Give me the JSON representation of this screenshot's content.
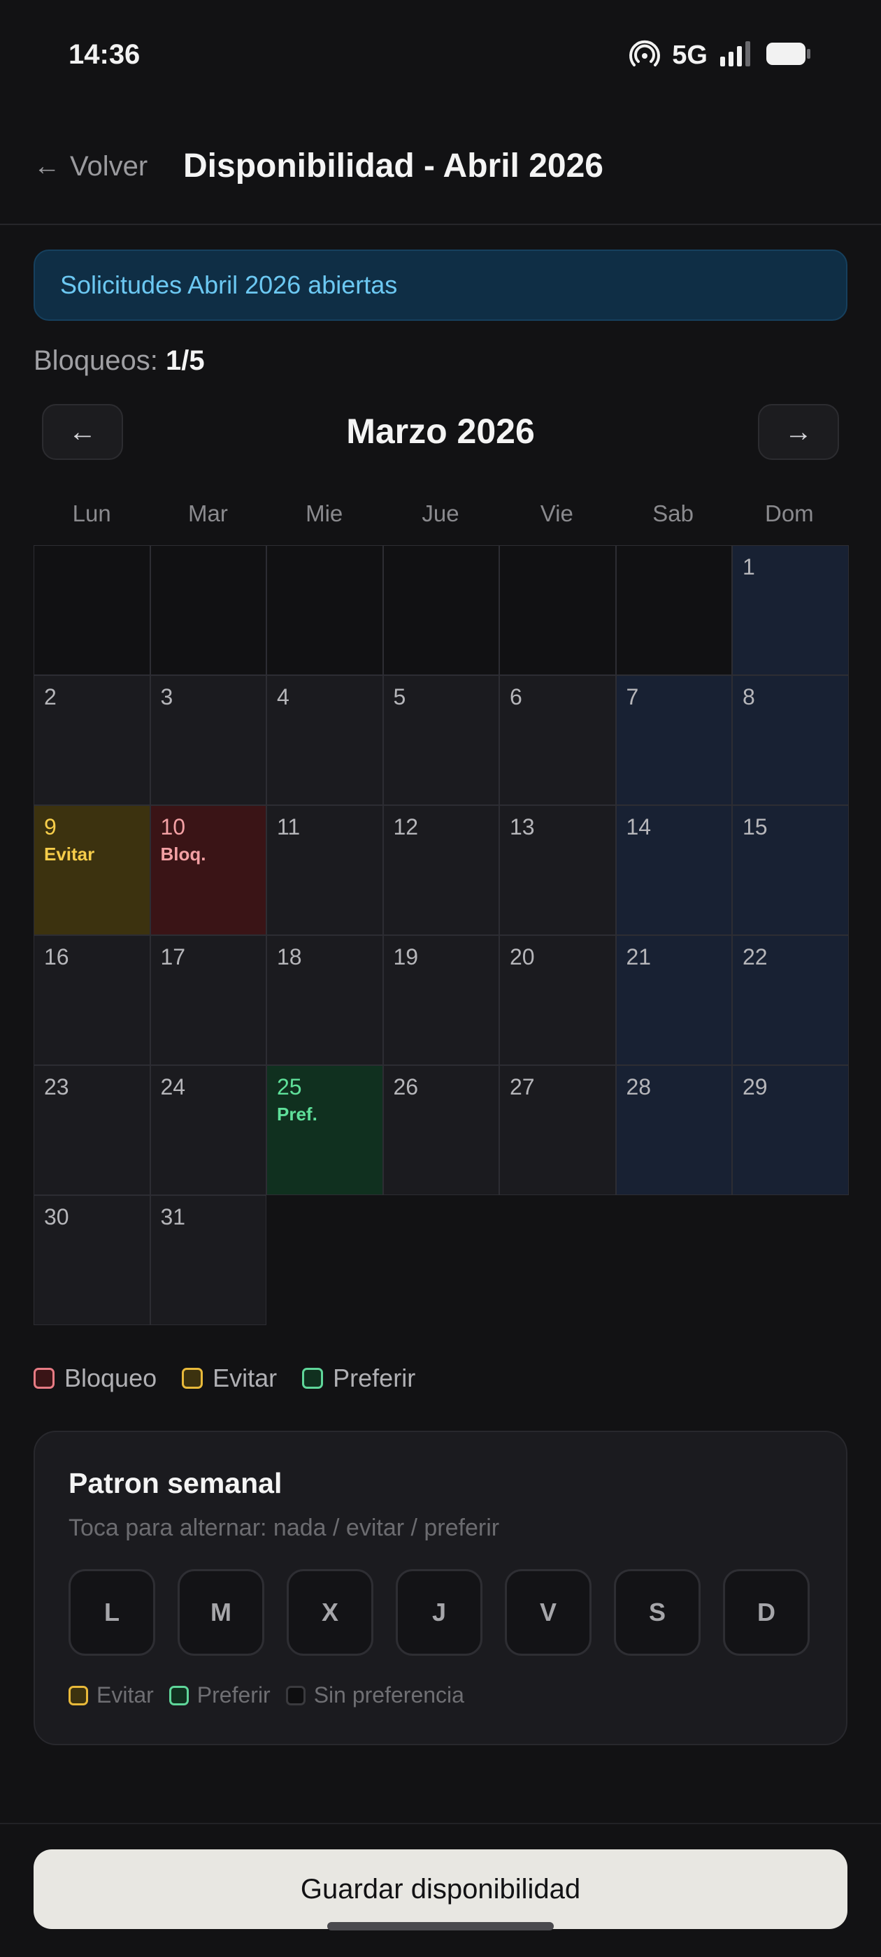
{
  "status_bar": {
    "time": "14:36",
    "network": "5G",
    "icons": [
      "hotspot-icon",
      "signal-icon",
      "battery-icon"
    ]
  },
  "header": {
    "back_label": "Volver",
    "back_arrow": "←",
    "title": "Disponibilidad - Abril 2026"
  },
  "banner": {
    "text": "Solicitudes Abril 2026 abiertas"
  },
  "blocks": {
    "label": "Bloqueos:",
    "value": "1/5"
  },
  "calendar": {
    "prev_label": "←",
    "next_label": "→",
    "month_title": "Marzo 2026",
    "weekdays": [
      "Lun",
      "Mar",
      "Mie",
      "Jue",
      "Vie",
      "Sab",
      "Dom"
    ],
    "leading_empty": 6,
    "days": [
      {
        "n": "1",
        "state": "weekend",
        "tag": ""
      },
      {
        "n": "2",
        "state": "",
        "tag": ""
      },
      {
        "n": "3",
        "state": "",
        "tag": ""
      },
      {
        "n": "4",
        "state": "",
        "tag": ""
      },
      {
        "n": "5",
        "state": "",
        "tag": ""
      },
      {
        "n": "6",
        "state": "",
        "tag": ""
      },
      {
        "n": "7",
        "state": "weekend",
        "tag": ""
      },
      {
        "n": "8",
        "state": "weekend",
        "tag": ""
      },
      {
        "n": "9",
        "state": "evitar",
        "tag": "Evitar"
      },
      {
        "n": "10",
        "state": "bloqueo",
        "tag": "Bloq."
      },
      {
        "n": "11",
        "state": "",
        "tag": ""
      },
      {
        "n": "12",
        "state": "",
        "tag": ""
      },
      {
        "n": "13",
        "state": "",
        "tag": ""
      },
      {
        "n": "14",
        "state": "weekend",
        "tag": ""
      },
      {
        "n": "15",
        "state": "weekend",
        "tag": ""
      },
      {
        "n": "16",
        "state": "",
        "tag": ""
      },
      {
        "n": "17",
        "state": "",
        "tag": ""
      },
      {
        "n": "18",
        "state": "",
        "tag": ""
      },
      {
        "n": "19",
        "state": "",
        "tag": ""
      },
      {
        "n": "20",
        "state": "",
        "tag": ""
      },
      {
        "n": "21",
        "state": "weekend",
        "tag": ""
      },
      {
        "n": "22",
        "state": "weekend",
        "tag": ""
      },
      {
        "n": "23",
        "state": "",
        "tag": ""
      },
      {
        "n": "24",
        "state": "",
        "tag": ""
      },
      {
        "n": "25",
        "state": "preferir",
        "tag": "Pref."
      },
      {
        "n": "26",
        "state": "",
        "tag": ""
      },
      {
        "n": "27",
        "state": "",
        "tag": ""
      },
      {
        "n": "28",
        "state": "weekend",
        "tag": ""
      },
      {
        "n": "29",
        "state": "weekend",
        "tag": ""
      },
      {
        "n": "30",
        "state": "",
        "tag": ""
      },
      {
        "n": "31",
        "state": "",
        "tag": ""
      }
    ]
  },
  "legend": {
    "bloqueo": "Bloqueo",
    "evitar": "Evitar",
    "preferir": "Preferir"
  },
  "pattern": {
    "title": "Patron semanal",
    "subtitle": "Toca para alternar: nada / evitar / preferir",
    "days": [
      "L",
      "M",
      "X",
      "J",
      "V",
      "S",
      "D"
    ],
    "legend": {
      "evitar": "Evitar",
      "preferir": "Preferir",
      "none": "Sin preferencia"
    }
  },
  "save_button": "Guardar disponibilidad",
  "colors": {
    "bloqueo": "#e77b84",
    "evitar": "#e8b93a",
    "preferir": "#5fd69a",
    "weekend_bg": "#182133",
    "banner_text": "#6cc8f2"
  }
}
